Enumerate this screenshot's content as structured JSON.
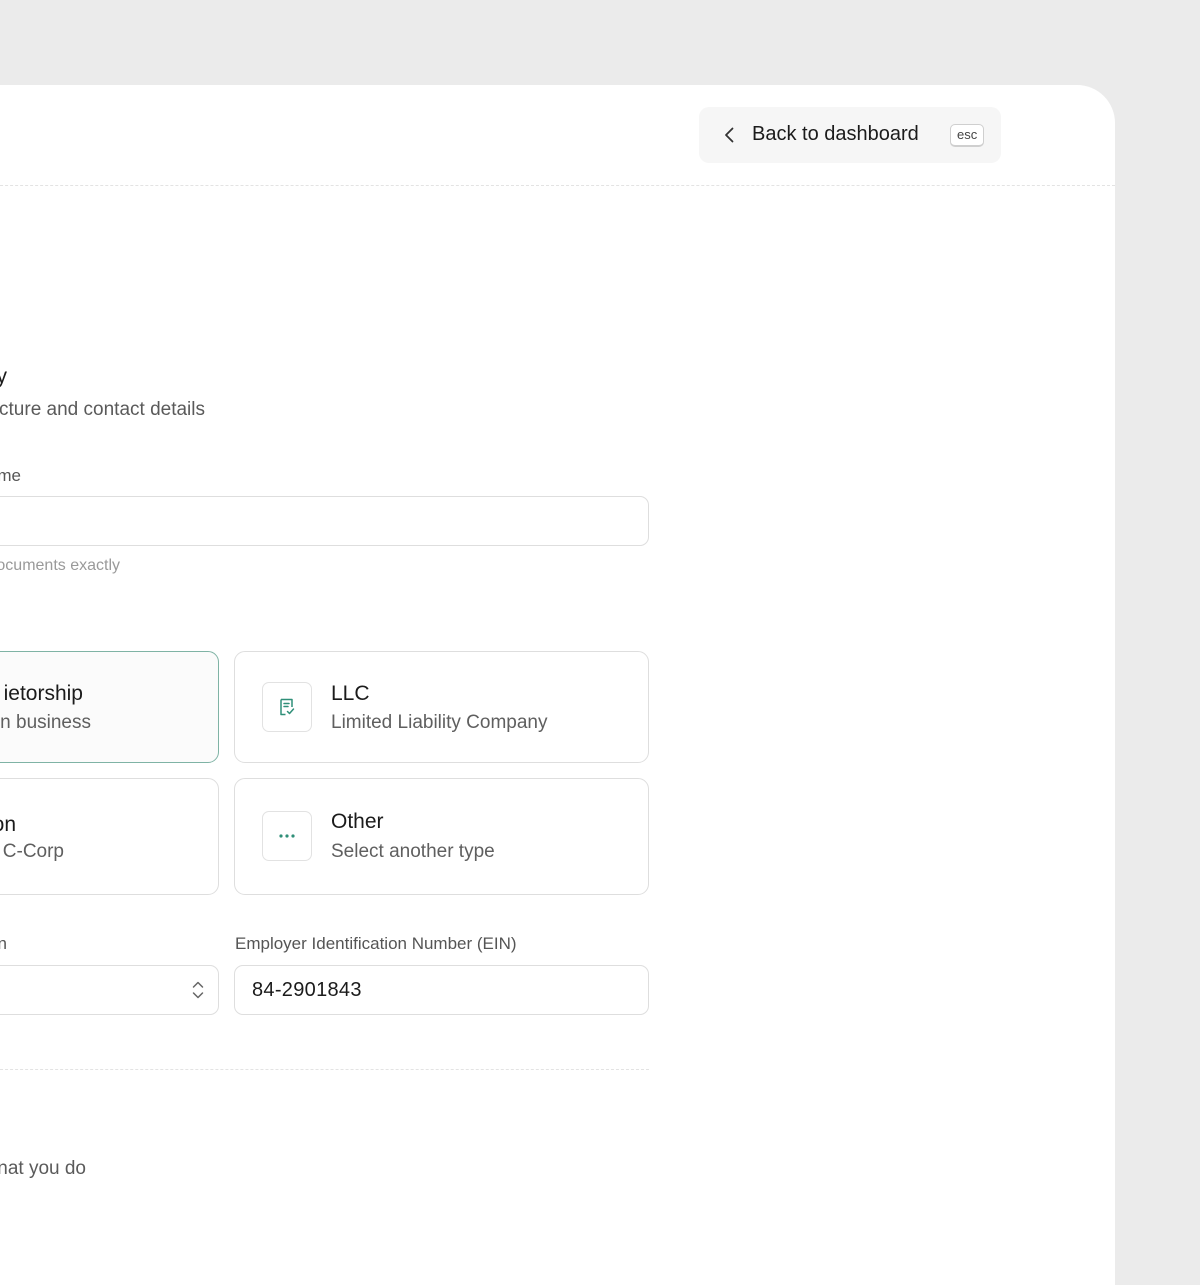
{
  "header": {
    "back_label": "Back to dashboard",
    "shortcut": "esc"
  },
  "section": {
    "title_fragment": "y",
    "subtitle_fragment": "structure and contact details"
  },
  "legal_name": {
    "label_fragment": "me",
    "value": "",
    "hint_fragment": "on documents exactly"
  },
  "entity_types": [
    {
      "title": "ietorship",
      "subtitle": "n business",
      "icon": "none-visible",
      "selected": true
    },
    {
      "title": "LLC",
      "subtitle": "Limited Liability Company",
      "icon": "document-check-icon",
      "selected": false
    },
    {
      "title": "on",
      "subtitle": "C-Corp",
      "icon": "none-visible",
      "selected": false
    },
    {
      "title": "Other",
      "subtitle": "Select another type",
      "icon": "more-dots-icon",
      "selected": false
    }
  ],
  "state_field": {
    "label_fragment": "n",
    "value": ""
  },
  "ein_field": {
    "label": "Employer Identification Number (EIN)",
    "value": "84-2901843"
  },
  "next_section": {
    "subtitle_fragment": "nat you do"
  },
  "colors": {
    "accent": "#2f8f78",
    "selected_border": "#7fb3a5",
    "background": "#ebebeb"
  }
}
